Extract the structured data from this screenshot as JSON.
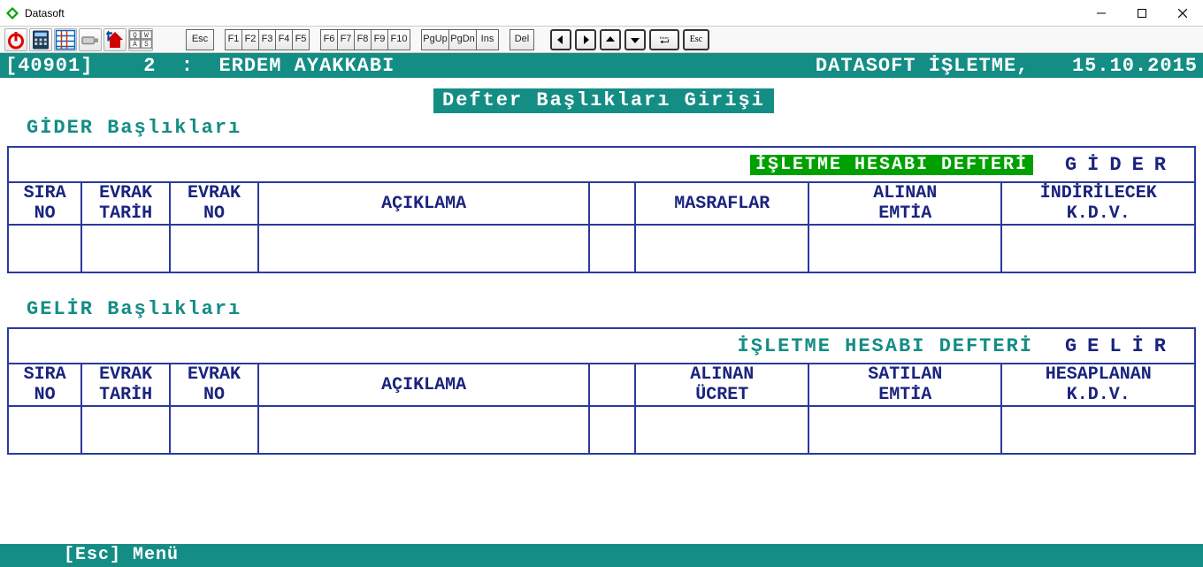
{
  "window": {
    "title": "Datasoft"
  },
  "toolbar": {
    "keys_a": [
      "Esc"
    ],
    "keys_b": [
      "F1",
      "F2",
      "F3",
      "F4",
      "F5"
    ],
    "keys_c": [
      "F6",
      "F7",
      "F8",
      "F9",
      "F10"
    ],
    "keys_d": [
      "PgUp",
      "PgDn",
      "Ins"
    ],
    "keys_e": [
      "Del"
    ],
    "nav_enter": "Enter",
    "nav_esc": "Esc"
  },
  "ribbon": {
    "code": "[40901]",
    "company_num": "2",
    "sep": ":",
    "company": "ERDEM AYAKKABI",
    "product": "DATASOFT İŞLETME,",
    "date": "15.10.2015"
  },
  "banner": "Defter Başlıkları Girişi",
  "gider": {
    "section_label": "GİDER Başlıkları",
    "title_hl": "İŞLETME HESABI DEFTERİ",
    "title_side": "GİDER",
    "cols": {
      "sira": "SIRA\nNO",
      "etarih": "EVRAK\nTARİH",
      "eno": "EVRAK\nNO",
      "aciklama": "AÇIKLAMA",
      "c1": "MASRAFLAR",
      "c2": "ALINAN\nEMTİA",
      "c3": "İNDİRİLECEK\nK.D.V."
    }
  },
  "gelir": {
    "section_label": "GELİR Başlıkları",
    "title_hl": "İŞLETME HESABI DEFTERİ",
    "title_side": "GELİR",
    "cols": {
      "sira": "SIRA\nNO",
      "etarih": "EVRAK\nTARİH",
      "eno": "EVRAK\nNO",
      "aciklama": "AÇIKLAMA",
      "c1": "ALINAN\nÜCRET",
      "c2": "SATILAN\nEMTİA",
      "c3": "HESAPLANAN\nK.D.V."
    }
  },
  "footer": {
    "text": "[Esc] Menü"
  }
}
